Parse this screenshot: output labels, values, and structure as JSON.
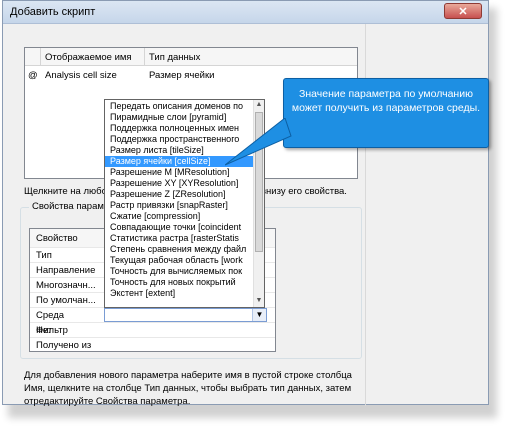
{
  "window": {
    "title": "Добавить скрипт"
  },
  "grid": {
    "columns": [
      "Отображаемое имя",
      "Тип данных"
    ],
    "rows": [
      {
        "marker": "@",
        "name": "Analysis cell size",
        "type": "Размер ячейки"
      }
    ]
  },
  "help": {
    "left": "Щелкните на любо",
    "right": "внизу его свойства."
  },
  "properties": {
    "group_label": "Свойства параме",
    "header": "Свойство",
    "rows": [
      {
        "name": "Тип",
        "value": ""
      },
      {
        "name": "Направление",
        "value": ""
      },
      {
        "name": "Многозначн...",
        "value": ""
      },
      {
        "name": "По умолчан...",
        "value": ""
      },
      {
        "name": "Среда",
        "value": ""
      },
      {
        "name": "Фильтр",
        "value": "Нет"
      },
      {
        "name": "Получено из",
        "value": ""
      }
    ]
  },
  "dropdown": {
    "selected": "Размер ячейки [cellSize]",
    "items": [
      "Передать описания доменов по",
      "Пирамидные слои [pyramid]",
      "Поддержка полноценных имен",
      "Поддержка пространственного",
      "Размер листа [tileSize]",
      "Размер ячейки [cellSize]",
      "Разрешение M [MResolution]",
      "Разрешение XY [XYResolution]",
      "Разрешение Z [ZResolution]",
      "Растр привязки [snapRaster]",
      "Сжатие [compression]",
      "Совпадающие точки [coincident",
      "Статистика растра [rasterStatis",
      "Степень сравнения между файл",
      "Текущая рабочая область [work",
      "Точность для вычисляемых пок",
      "Точность для новых покрытий",
      "Экстент [extent]"
    ]
  },
  "bottom_help": "Для добавления нового параметра наберите имя в пустой строке столбца Имя, щелкните на столбце Тип данных, чтобы выбрать тип данных, затем отредактируйте Свойства параметра.",
  "callout": {
    "text": "Значение параметра по умолчанию может получить из параметров среды."
  },
  "colors": {
    "callout": "#1e8fe3",
    "selection": "#3399ff"
  }
}
